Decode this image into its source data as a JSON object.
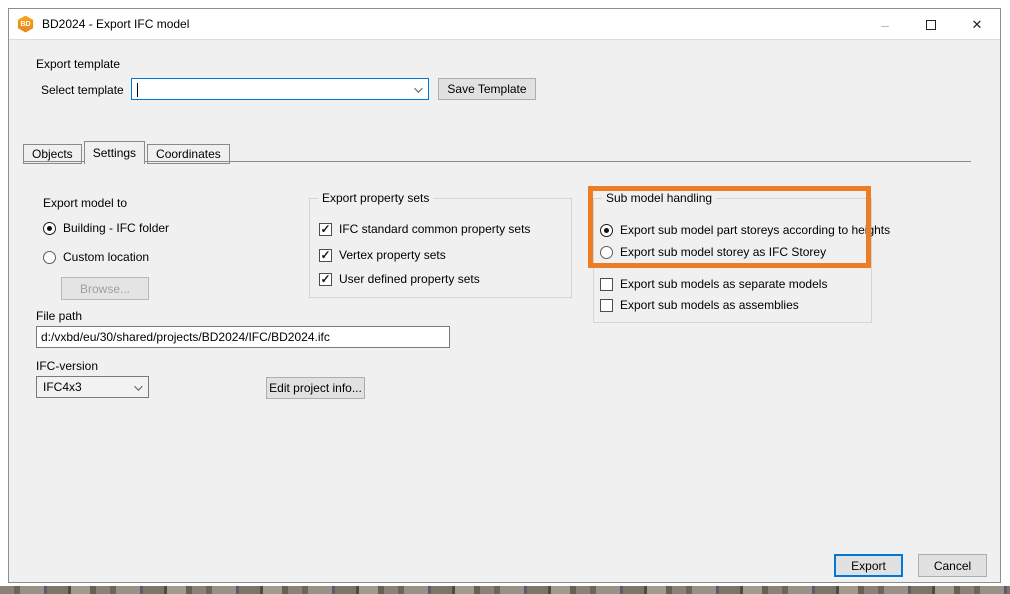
{
  "window": {
    "title": "BD2024 - Export IFC model",
    "icon_text": "BD",
    "minimize_glyph": "–",
    "close_glyph": "✕"
  },
  "template_section": {
    "heading": "Export template",
    "select_label": "Select template",
    "combo_value": "",
    "save_button_label": "Save Template"
  },
  "tabs": {
    "objects": "Objects",
    "settings": "Settings",
    "coordinates": "Coordinates",
    "active_tab": "Settings"
  },
  "content": {
    "export_model_to": {
      "heading": "Export model to",
      "radio_building": {
        "label": "Building - IFC folder",
        "selected": true
      },
      "radio_custom": {
        "label": "Custom location",
        "selected": false
      },
      "browse_button_label": "Browse...",
      "browse_enabled": false
    },
    "file_path": {
      "label": "File path",
      "value": "d:/vxbd/eu/30/shared/projects/BD2024/IFC/BD2024.ifc"
    },
    "ifc_version": {
      "label": "IFC-version",
      "selected_value": "IFC4x3"
    },
    "edit_project_info_label": "Edit project info...",
    "property_sets": {
      "title": "Export property sets",
      "items": [
        {
          "label": "IFC standard common property sets",
          "checked": true
        },
        {
          "label": "Vertex property sets",
          "checked": true
        },
        {
          "label": "User defined property sets",
          "checked": true
        }
      ]
    },
    "sub_model": {
      "title": "Sub model handling",
      "radio_part_storeys": {
        "label": "Export sub model part storeys according to heights",
        "selected": true
      },
      "radio_ifc_storey": {
        "label": "Export sub model storey as IFC Storey",
        "selected": false
      },
      "check_separate": {
        "label": "Export sub models as separate models",
        "checked": false
      },
      "check_assemblies": {
        "label": "Export sub models as assemblies",
        "checked": false
      }
    }
  },
  "footer": {
    "export_label": "Export",
    "cancel_label": "Cancel"
  },
  "glyphs": {
    "check": "✓"
  },
  "colors": {
    "focus_blue": "#0078d7",
    "highlight_orange": "#ed7c23",
    "icon_orange_top": "#f7a81b",
    "icon_orange_bottom": "#e8821e"
  }
}
